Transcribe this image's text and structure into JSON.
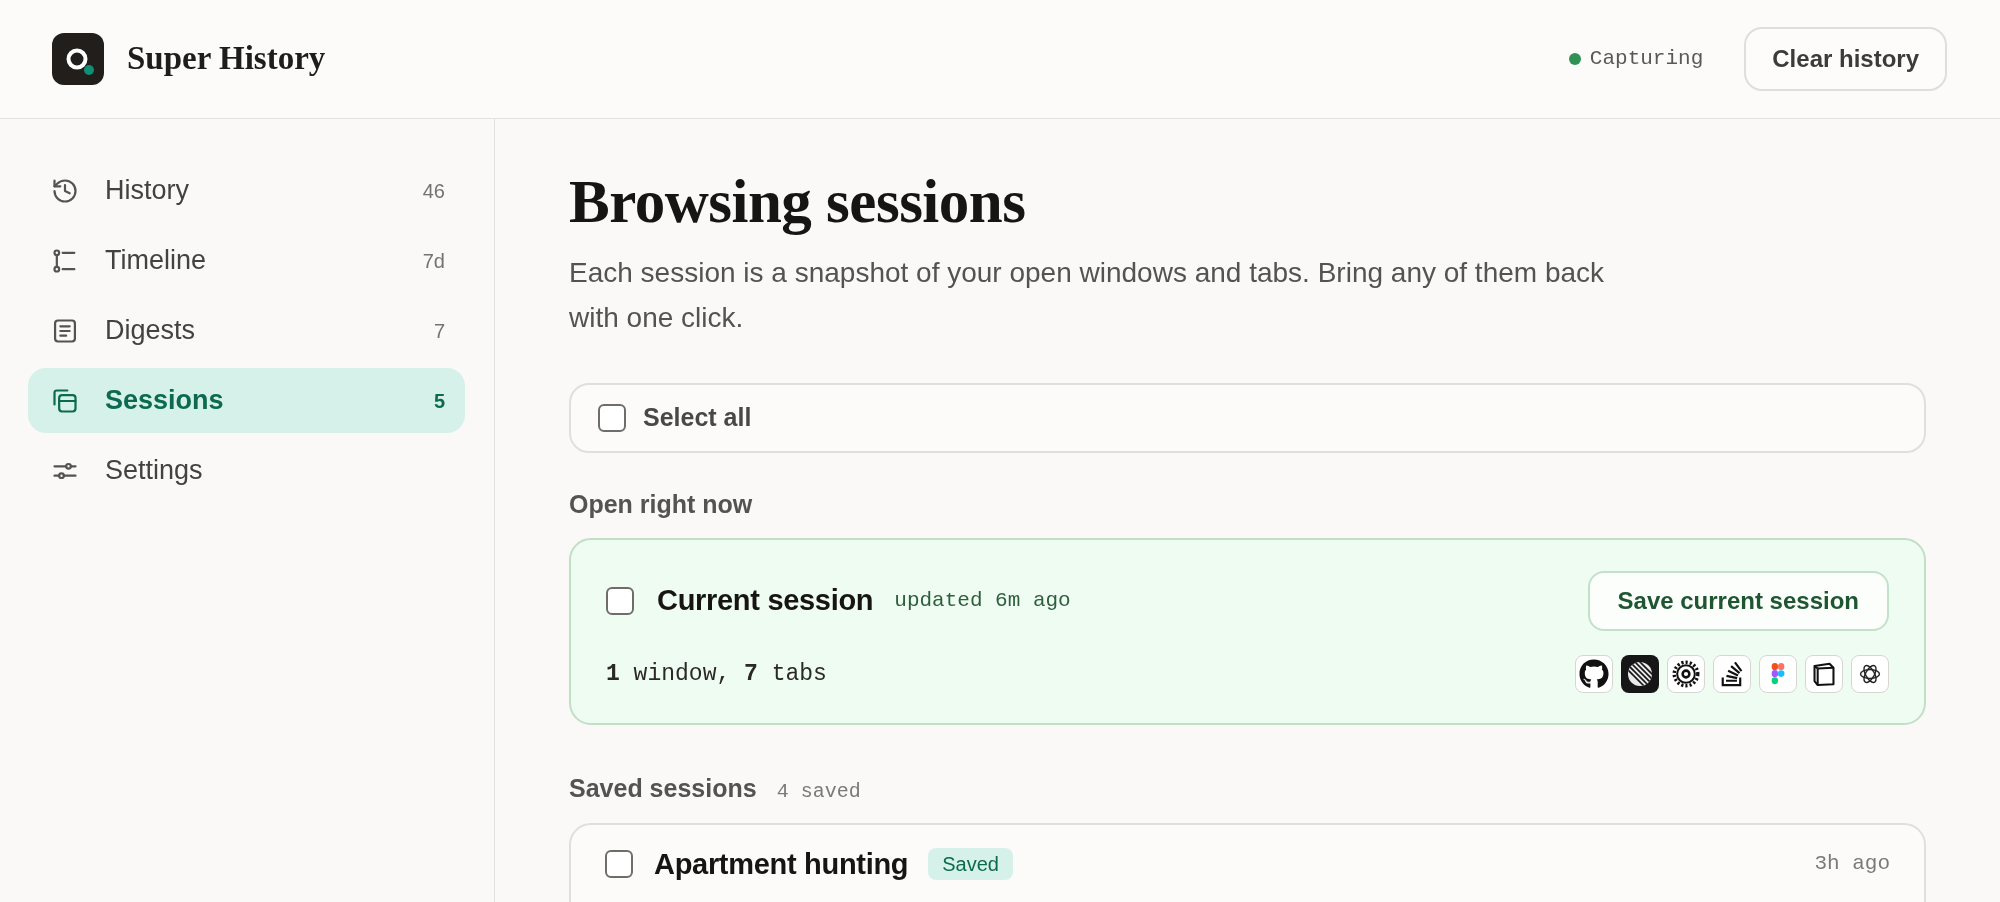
{
  "app": {
    "title": "Super History"
  },
  "header": {
    "status": {
      "label": "Capturing",
      "color": "#2f9254"
    },
    "clear_button": "Clear history"
  },
  "sidebar": {
    "items": [
      {
        "kind": "clock",
        "label": "History",
        "count": "46",
        "selected": false
      },
      {
        "kind": "timeline",
        "label": "Timeline",
        "count": "7d",
        "selected": false
      },
      {
        "kind": "document",
        "label": "Digests",
        "count": "7",
        "selected": false
      },
      {
        "kind": "windows",
        "label": "Sessions",
        "count": "5",
        "selected": true
      },
      {
        "kind": "sliders",
        "label": "Settings",
        "selected": false
      }
    ]
  },
  "page": {
    "title": "Browsing sessions",
    "description": "Each session is a snapshot of your open windows and tabs. Bring any of them back with one click."
  },
  "select_all": {
    "label": "Select all",
    "checked": false
  },
  "current": {
    "heading": "Open right now",
    "session": {
      "title": "Current session",
      "updated": "updated 6m ago",
      "summary": "**1** window, **7** tabs",
      "checked": false,
      "save_button": "Save current session",
      "favicons": [
        {
          "kind": "cat"
        },
        {
          "kind": "stripes"
        },
        {
          "kind": "gear"
        },
        {
          "kind": "stack"
        },
        {
          "kind": "shapes"
        },
        {
          "kind": "box"
        },
        {
          "kind": "atom"
        }
      ]
    }
  },
  "saved": {
    "heading": "Saved sessions",
    "count": "4 saved",
    "sessions": [
      {
        "title": "Apartment hunting",
        "badge": "Saved",
        "time": "3h ago",
        "checked": false
      }
    ]
  }
}
